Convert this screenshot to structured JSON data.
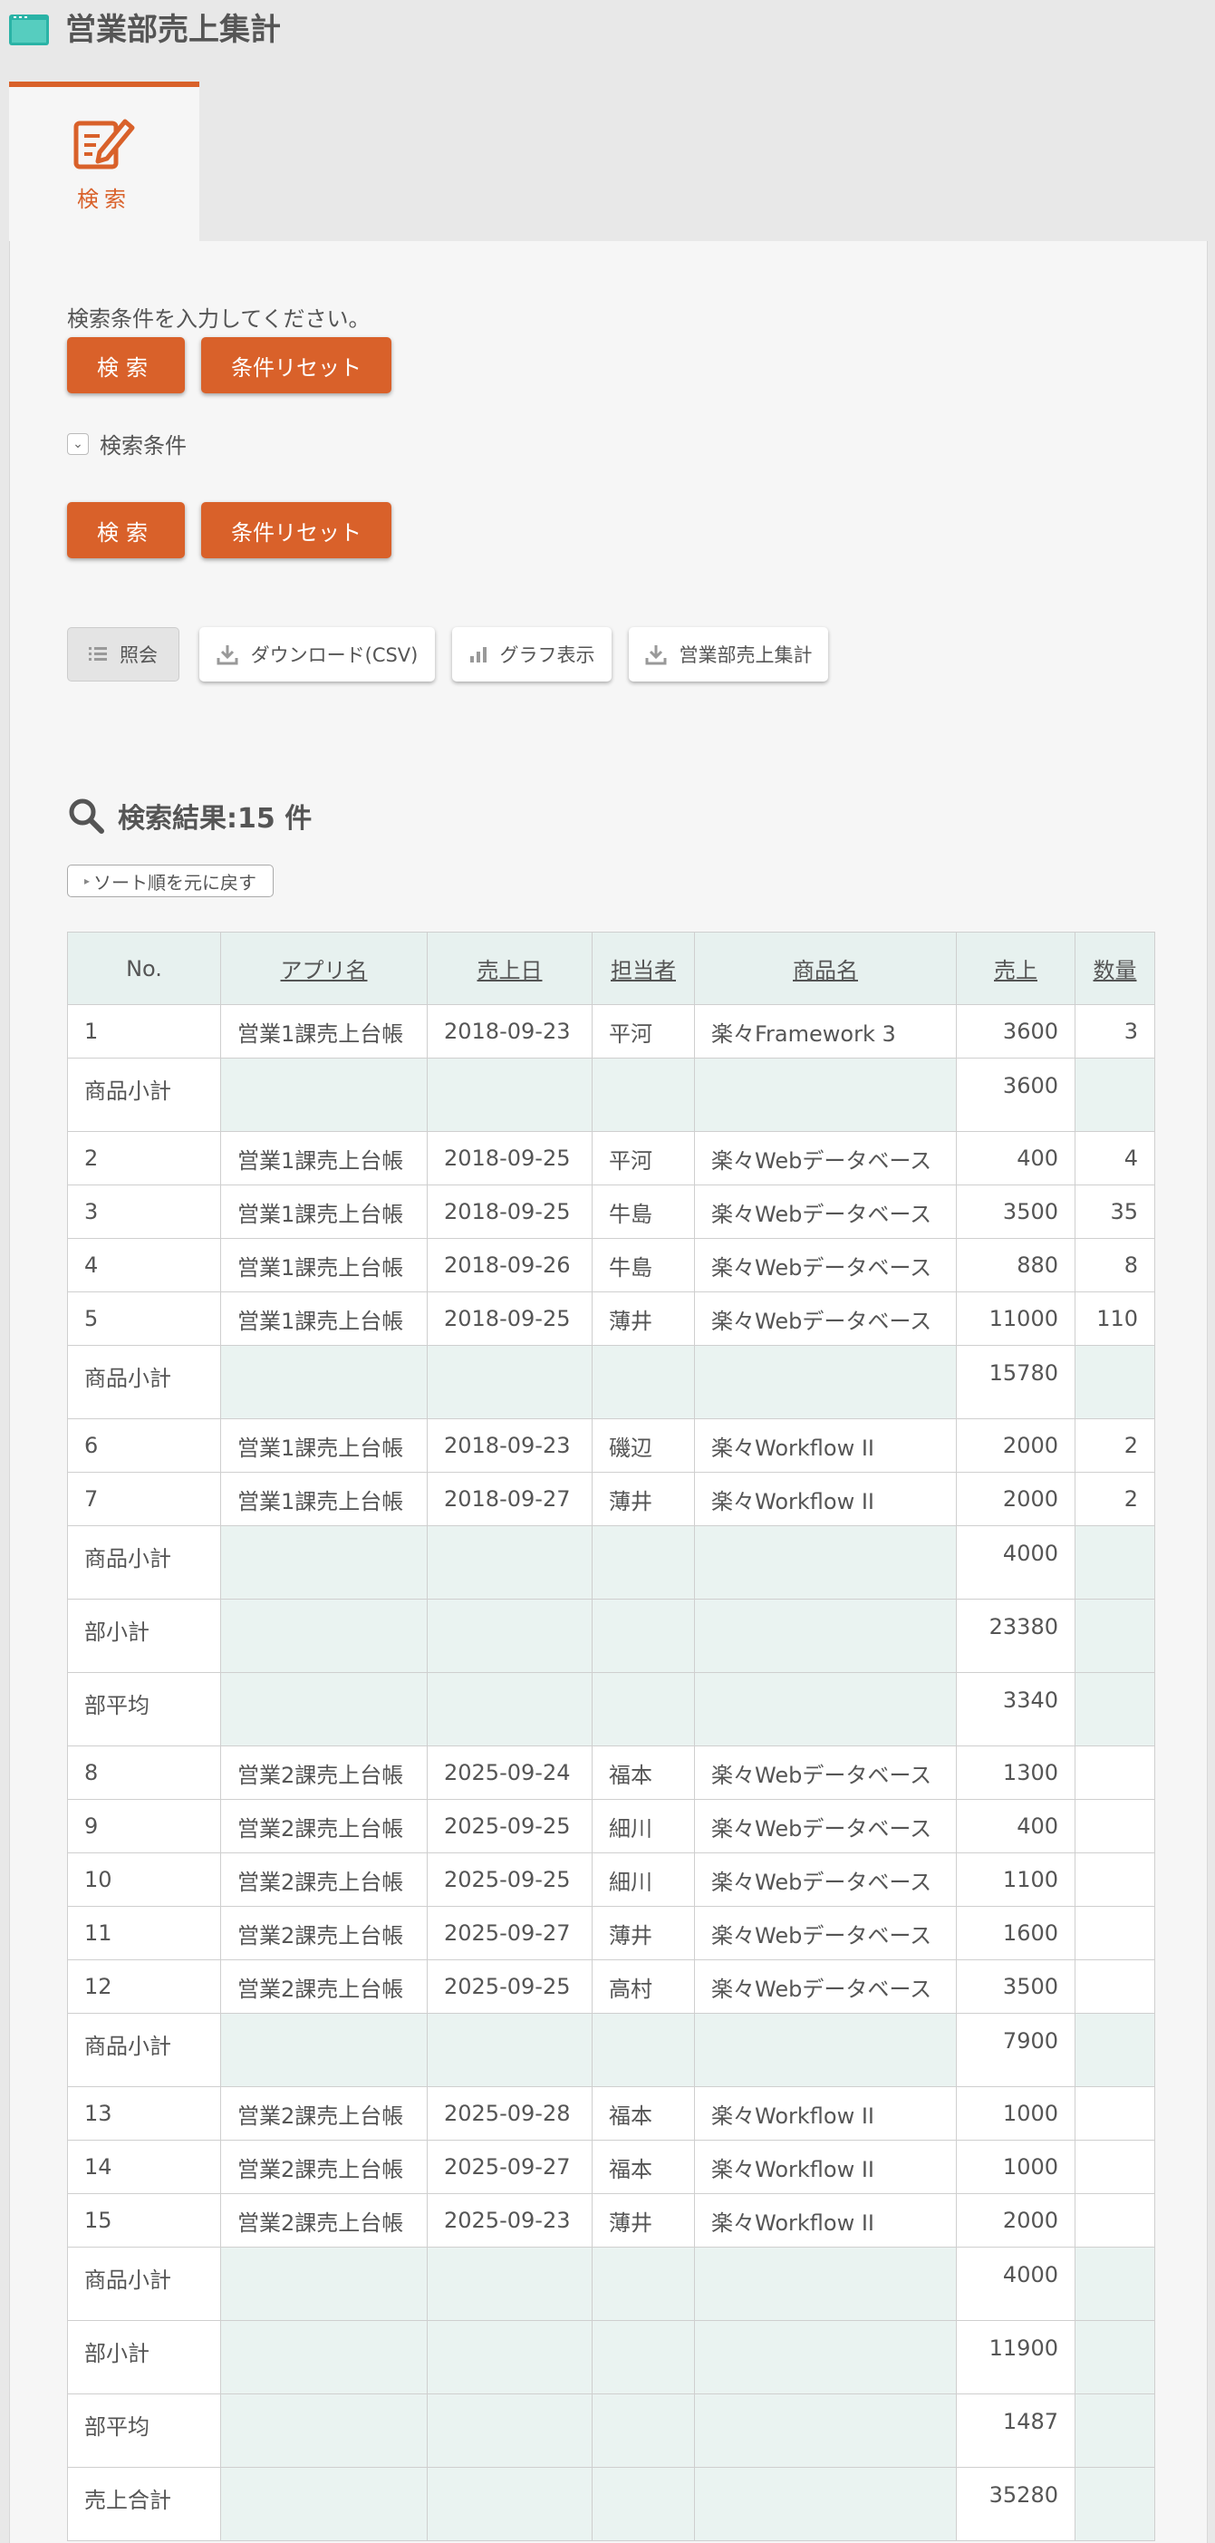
{
  "header": {
    "title": "営業部売上集計"
  },
  "tab": {
    "label": "検索"
  },
  "form": {
    "hint": "検索条件を入力してください。",
    "search_label": "検索",
    "reset_label": "条件リセット",
    "conditions_label": "検索条件"
  },
  "toolbar": {
    "view_label": "照会",
    "download_label": "ダウンロード(CSV)",
    "graph_label": "グラフ表示",
    "summary_label": "営業部売上集計"
  },
  "results": {
    "title": "検索結果:15 件",
    "sort_reset_label": "ソート順を元に戻す",
    "columns": [
      "No.",
      "アプリ名",
      "売上日",
      "担当者",
      "商品名",
      "売上",
      "数量"
    ],
    "rows": [
      {
        "type": "data",
        "no": "1",
        "app": "営業1課売上台帳",
        "date": "2018-09-23",
        "person": "平河",
        "product": "楽々Framework 3",
        "sales": "3600",
        "qty": "3"
      },
      {
        "type": "subtotal",
        "label": "商品小計",
        "sales": "3600"
      },
      {
        "type": "data",
        "no": "2",
        "app": "営業1課売上台帳",
        "date": "2018-09-25",
        "person": "平河",
        "product": "楽々Webデータベース",
        "sales": "400",
        "qty": "4"
      },
      {
        "type": "data",
        "no": "3",
        "app": "営業1課売上台帳",
        "date": "2018-09-25",
        "person": "牛島",
        "product": "楽々Webデータベース",
        "sales": "3500",
        "qty": "35"
      },
      {
        "type": "data",
        "no": "4",
        "app": "営業1課売上台帳",
        "date": "2018-09-26",
        "person": "牛島",
        "product": "楽々Webデータベース",
        "sales": "880",
        "qty": "8"
      },
      {
        "type": "data",
        "no": "5",
        "app": "営業1課売上台帳",
        "date": "2018-09-25",
        "person": "薄井",
        "product": "楽々Webデータベース",
        "sales": "11000",
        "qty": "110"
      },
      {
        "type": "subtotal",
        "label": "商品小計",
        "sales": "15780"
      },
      {
        "type": "data",
        "no": "6",
        "app": "営業1課売上台帳",
        "date": "2018-09-23",
        "person": "磯辺",
        "product": "楽々Workflow II",
        "sales": "2000",
        "qty": "2"
      },
      {
        "type": "data",
        "no": "7",
        "app": "営業1課売上台帳",
        "date": "2018-09-27",
        "person": "薄井",
        "product": "楽々Workflow II",
        "sales": "2000",
        "qty": "2"
      },
      {
        "type": "subtotal",
        "label": "商品小計",
        "sales": "4000"
      },
      {
        "type": "subtotal",
        "label": "部小計",
        "sales": "23380"
      },
      {
        "type": "subtotal",
        "label": "部平均",
        "sales": "3340"
      },
      {
        "type": "data",
        "no": "8",
        "app": "営業2課売上台帳",
        "date": "2025-09-24",
        "person": "福本",
        "product": "楽々Webデータベース",
        "sales": "1300",
        "qty": ""
      },
      {
        "type": "data",
        "no": "9",
        "app": "営業2課売上台帳",
        "date": "2025-09-25",
        "person": "細川",
        "product": "楽々Webデータベース",
        "sales": "400",
        "qty": ""
      },
      {
        "type": "data",
        "no": "10",
        "app": "営業2課売上台帳",
        "date": "2025-09-25",
        "person": "細川",
        "product": "楽々Webデータベース",
        "sales": "1100",
        "qty": ""
      },
      {
        "type": "data",
        "no": "11",
        "app": "営業2課売上台帳",
        "date": "2025-09-27",
        "person": "薄井",
        "product": "楽々Webデータベース",
        "sales": "1600",
        "qty": ""
      },
      {
        "type": "data",
        "no": "12",
        "app": "営業2課売上台帳",
        "date": "2025-09-25",
        "person": "高村",
        "product": "楽々Webデータベース",
        "sales": "3500",
        "qty": ""
      },
      {
        "type": "subtotal",
        "label": "商品小計",
        "sales": "7900"
      },
      {
        "type": "data",
        "no": "13",
        "app": "営業2課売上台帳",
        "date": "2025-09-28",
        "person": "福本",
        "product": "楽々Workflow II",
        "sales": "1000",
        "qty": ""
      },
      {
        "type": "data",
        "no": "14",
        "app": "営業2課売上台帳",
        "date": "2025-09-27",
        "person": "福本",
        "product": "楽々Workflow II",
        "sales": "1000",
        "qty": ""
      },
      {
        "type": "data",
        "no": "15",
        "app": "営業2課売上台帳",
        "date": "2025-09-23",
        "person": "薄井",
        "product": "楽々Workflow II",
        "sales": "2000",
        "qty": ""
      },
      {
        "type": "subtotal",
        "label": "商品小計",
        "sales": "4000"
      },
      {
        "type": "subtotal",
        "label": "部小計",
        "sales": "11900"
      },
      {
        "type": "subtotal",
        "label": "部平均",
        "sales": "1487"
      },
      {
        "type": "subtotal",
        "label": "売上合計",
        "sales": "35280"
      }
    ]
  },
  "colors": {
    "accent": "#d9612a",
    "teal": "#2ab3a6",
    "subtotal_bg": "#eaf3f1"
  }
}
